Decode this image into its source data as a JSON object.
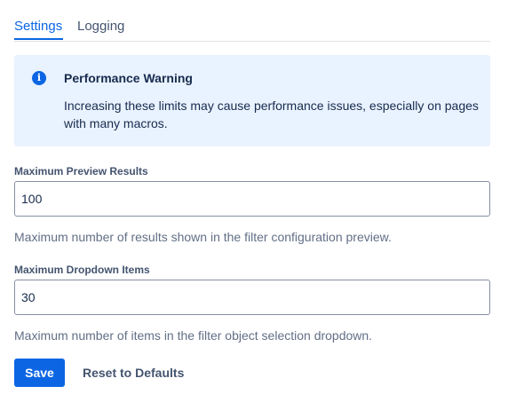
{
  "tabs": {
    "settings": "Settings",
    "logging": "Logging"
  },
  "banner": {
    "icon": "info-icon",
    "title": "Performance Warning",
    "text": "Increasing these limits may cause performance issues, especially on pages with many macros."
  },
  "fields": {
    "max_preview": {
      "label": "Maximum Preview Results",
      "value": "100",
      "help": "Maximum number of results shown in the filter configuration preview."
    },
    "max_dropdown": {
      "label": "Maximum Dropdown Items",
      "value": "30",
      "help": "Maximum number of items in the filter object selection dropdown."
    }
  },
  "actions": {
    "save": "Save",
    "reset": "Reset to Defaults"
  },
  "colors": {
    "accent": "#0c66e4",
    "banner_bg": "#e9f2ff"
  }
}
